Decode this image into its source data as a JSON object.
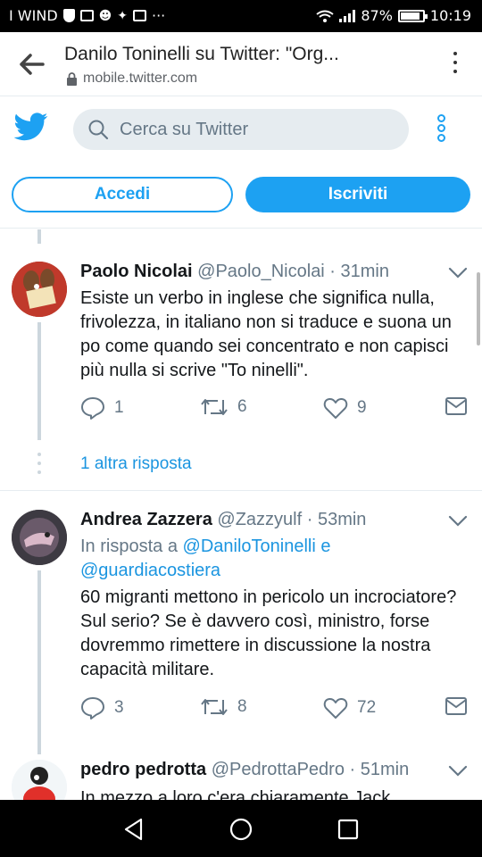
{
  "status_bar": {
    "carrier": "I WIND",
    "dots": "···",
    "battery": "87%",
    "battery_fraction": 0.87,
    "time": "10:19"
  },
  "browser": {
    "title": "Danilo Toninelli su Twitter: \"Org...",
    "url": "mobile.twitter.com"
  },
  "twitter_header": {
    "search_placeholder": "Cerca su Twitter",
    "login_label": "Accedi",
    "signup_label": "Iscriviti",
    "brand_color": "#1da1f2"
  },
  "tweets": [
    {
      "name": "Paolo Nicolai",
      "handle": "@Paolo_Nicolai · 31min",
      "text": "Esiste un verbo in inglese che significa nulla, frivolezza, in italiano non si traduce e suona un po come quando sei concentrato e non capisci più nulla si scrive \"To ninelli\".",
      "replies": "1",
      "retweets": "6",
      "likes": "9",
      "more_replies": "1 altra risposta"
    },
    {
      "name": "Andrea Zazzera",
      "handle": "@Zazzyulf · 53min",
      "reply_prefix": "In risposta a",
      "reply_user1": "@DaniloToninelli",
      "reply_and": "e",
      "reply_user2": "@guardiacostiera",
      "text": "60 migranti mettono in pericolo un incrociatore? Sul serio? Se è davvero così, ministro, forse dovremmo rimettere in discussione la nostra capacità militare.",
      "replies": "3",
      "retweets": "8",
      "likes": "72"
    },
    {
      "name": "pedro pedrotta",
      "handle": "@PedrottaPedro · 51min",
      "text": "In mezzo a loro c'era chiaramente Jack"
    }
  ]
}
